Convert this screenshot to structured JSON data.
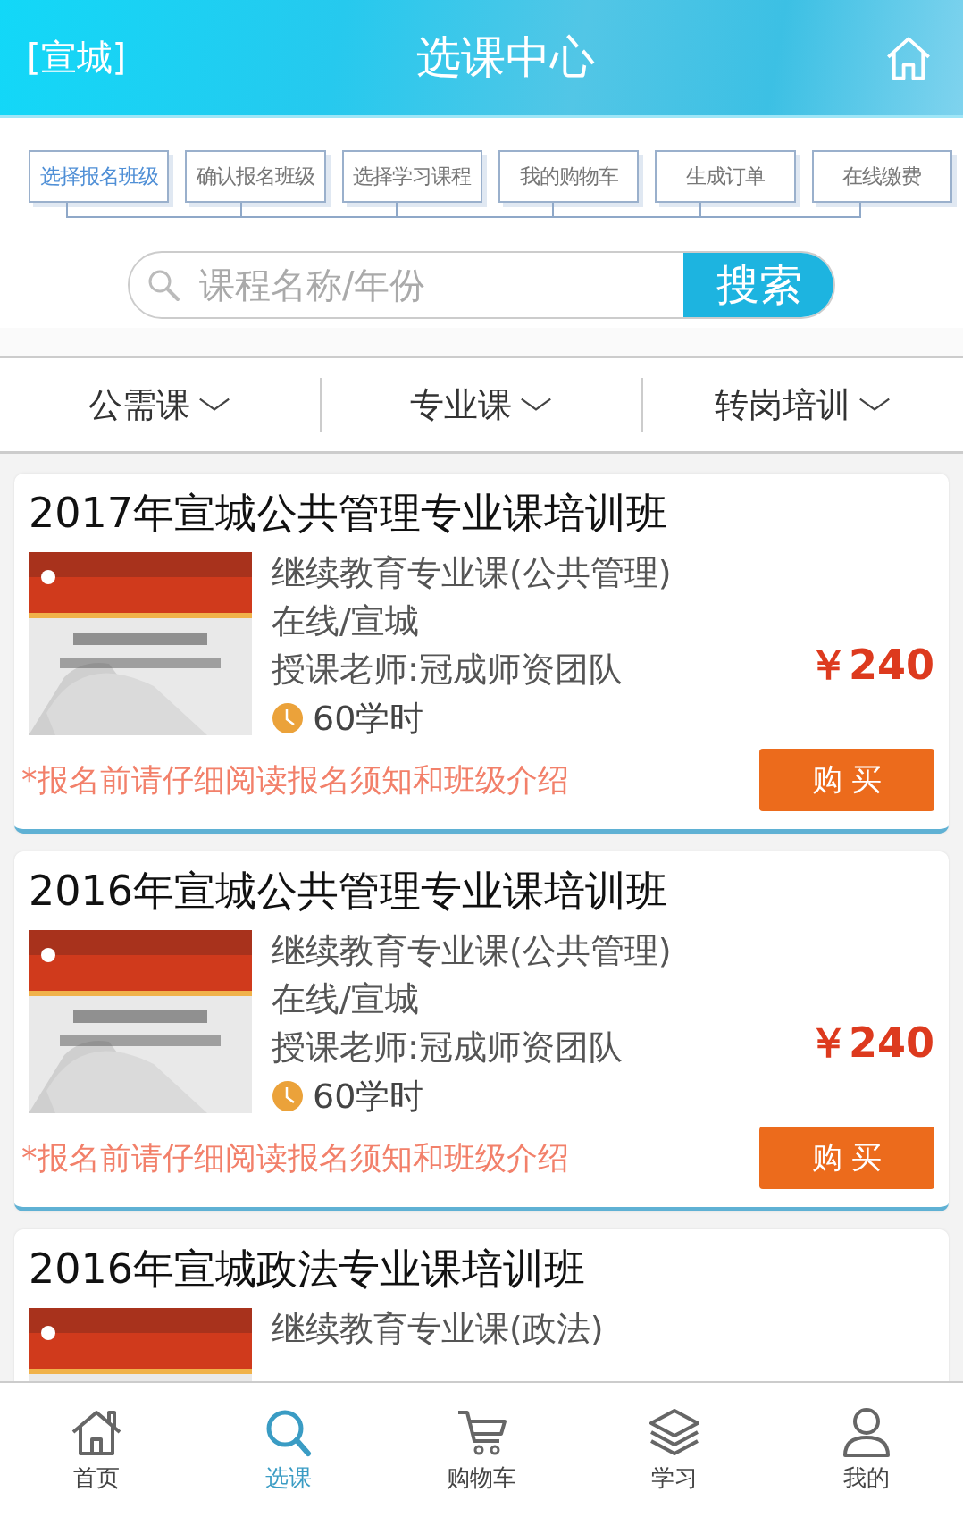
{
  "header": {
    "city": "[宣城]",
    "title": "选课中心"
  },
  "steps": [
    {
      "label": "选择报名班级",
      "selected": true
    },
    {
      "label": "确认报名班级",
      "selected": false
    },
    {
      "label": "选择学习课程",
      "selected": false
    },
    {
      "label": "我的购物车",
      "selected": false
    },
    {
      "label": "生成订单",
      "selected": false
    },
    {
      "label": "在线缴费",
      "selected": false
    }
  ],
  "search": {
    "placeholder": "课程名称/年份",
    "button": "搜索"
  },
  "filters": [
    {
      "label": "公需课"
    },
    {
      "label": "专业课"
    },
    {
      "label": "转岗培训"
    }
  ],
  "courses": [
    {
      "title": "2017年宣城公共管理专业课培训班",
      "category": "继续教育专业课(公共管理)",
      "location": "在线/宣城",
      "teacher": "授课老师:冠成师资团队",
      "hours": "60学时",
      "price": "￥240",
      "notice": "*报名前请仔细阅读报名须知和班级介绍",
      "button": "购 买"
    },
    {
      "title": "2016年宣城公共管理专业课培训班",
      "category": "继续教育专业课(公共管理)",
      "location": "在线/宣城",
      "teacher": "授课老师:冠成师资团队",
      "hours": "60学时",
      "price": "￥240",
      "notice": "*报名前请仔细阅读报名须知和班级介绍",
      "button": "购 买"
    },
    {
      "title": "2016年宣城政法专业课培训班",
      "category": "继续教育专业课(政法)"
    }
  ],
  "nav": [
    {
      "kind": "home",
      "label": "首页",
      "selected": false
    },
    {
      "kind": "search",
      "label": "选课",
      "selected": true
    },
    {
      "kind": "cart",
      "label": "购物车",
      "selected": false
    },
    {
      "kind": "layers",
      "label": "学习",
      "selected": false
    },
    {
      "kind": "user",
      "label": "我的",
      "selected": false
    }
  ]
}
